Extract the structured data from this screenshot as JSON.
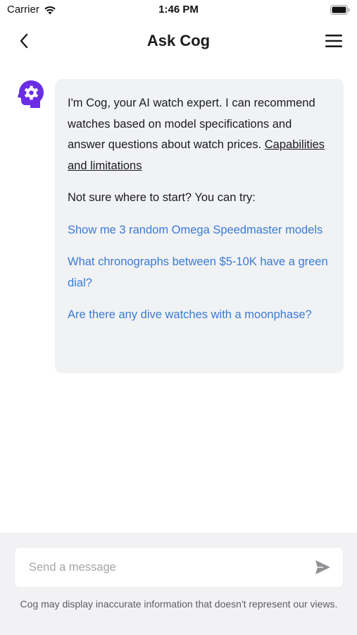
{
  "status_bar": {
    "carrier": "Carrier",
    "time": "1:46 PM",
    "wifi_icon": "wifi-icon",
    "battery_icon": "battery-full-icon"
  },
  "nav": {
    "title": "Ask Cog",
    "back_icon": "chevron-left-icon",
    "menu_icon": "hamburger-menu-icon"
  },
  "chat": {
    "avatar_icon": "gear-head-icon",
    "intro_text": "I'm Cog, your AI watch expert. I can recommend watches based on model specifications and answer questions about watch prices. ",
    "capabilities_link": "Capabilities and limitations",
    "try_label": "Not sure where to start? You can try:",
    "suggestions": [
      "Show me 3 random Omega Speedmaster models",
      "What chronographs between $5-10K have a green dial?",
      "Are there any dive watches with a moonphase?"
    ]
  },
  "composer": {
    "placeholder": "Send a message",
    "value": "",
    "send_icon": "send-icon",
    "disclaimer": "Cog may display inaccurate information that doesn't represent our views."
  },
  "colors": {
    "accent": "#6b2ee6",
    "link": "#3a7bd5",
    "bubble": "#f1f2f4"
  }
}
